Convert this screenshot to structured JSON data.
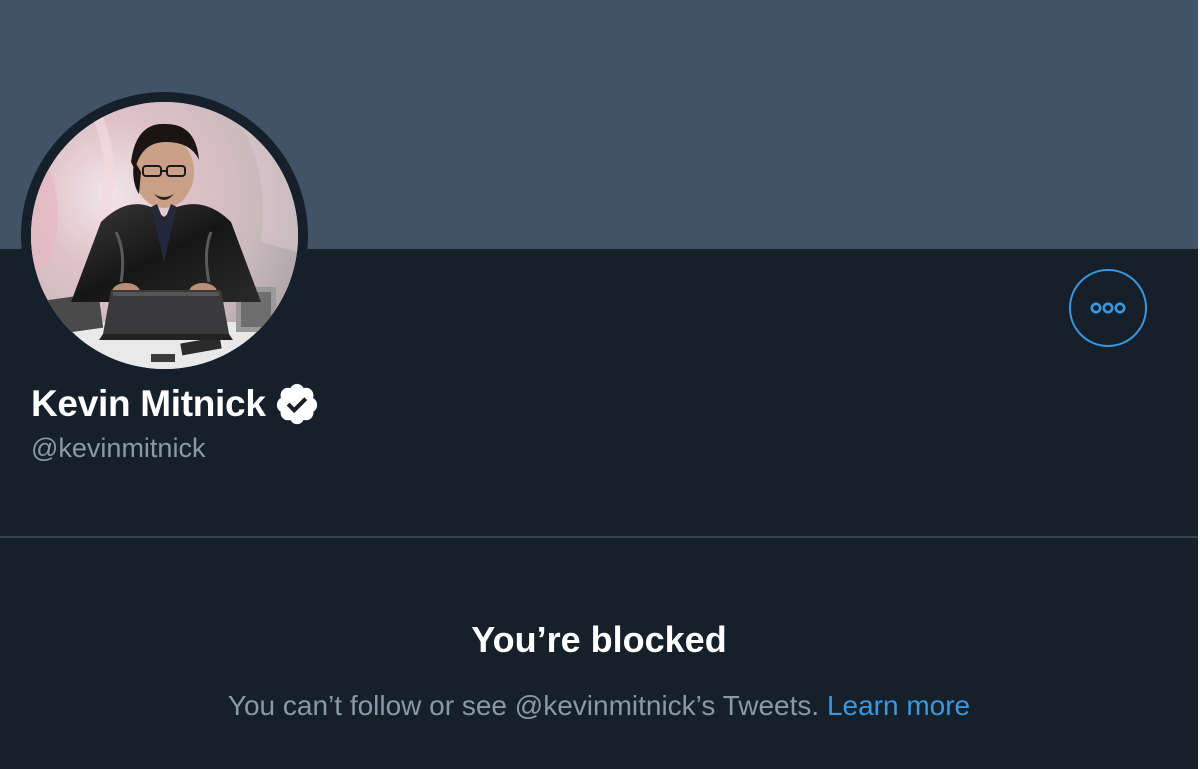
{
  "profile": {
    "display_name": "Kevin Mitnick",
    "handle": "@kevinmitnick",
    "verified": true,
    "avatar_icon": "profile-photo",
    "more_icon": "more-options-icon"
  },
  "blocked": {
    "title": "You’re blocked",
    "message": "You can’t follow or see @kevinmitnick’s Tweets.",
    "learn_more": "Learn more"
  },
  "colors": {
    "background": "#15202b",
    "banner": "#415366",
    "accent": "#3a97e0",
    "secondary_text": "#8b98a5",
    "divider": "#38444d"
  }
}
